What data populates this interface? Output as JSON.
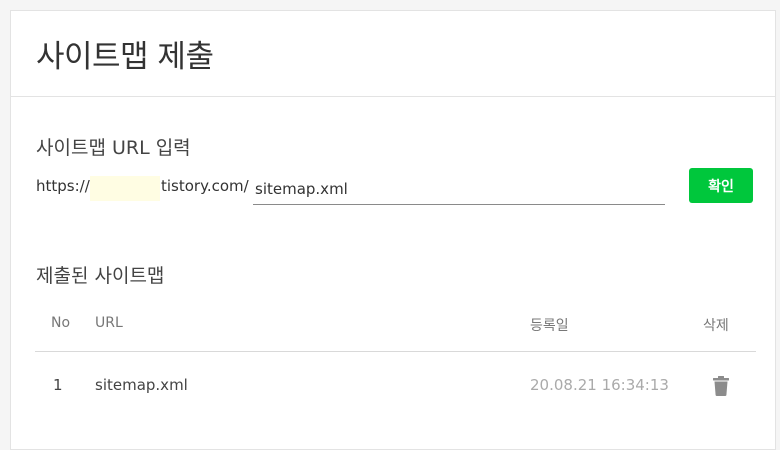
{
  "header": {
    "title": "사이트맵 제출"
  },
  "sitemap_form": {
    "section_title": "사이트맵 URL 입력",
    "url_prefix": "https://",
    "url_suffix": "tistory.com/",
    "input_value": "sitemap.xml",
    "confirm_label": "확인"
  },
  "submitted": {
    "section_title": "제출된 사이트맵",
    "columns": {
      "no": "No",
      "url": "URL",
      "date": "등록일",
      "delete": "삭제"
    },
    "rows": [
      {
        "no": "1",
        "url": "sitemap.xml",
        "date": "20.08.21 16:34:13",
        "delete_icon": "trash-icon"
      }
    ]
  },
  "colors": {
    "accent": "#00c73c",
    "highlight": "#fffde3",
    "muted_text": "#aaaaaa"
  }
}
